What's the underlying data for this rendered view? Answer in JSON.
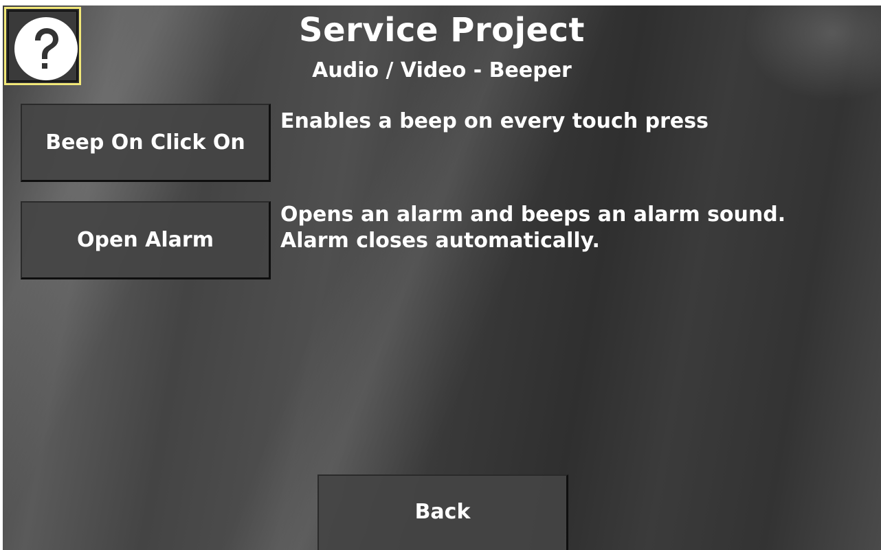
{
  "header": {
    "title": "Service Project",
    "subtitle": "Audio / Video - Beeper"
  },
  "help_button": {
    "icon": "question-mark-icon",
    "highlight_color": "#f2e879"
  },
  "items": [
    {
      "button_label": "Beep On Click On",
      "description_lines": [
        "Enables a beep on every touch press"
      ]
    },
    {
      "button_label": "Open Alarm",
      "description_lines": [
        "Opens an alarm and beeps an alarm sound.",
        "Alarm closes automatically."
      ]
    }
  ],
  "footer": {
    "back_label": "Back"
  }
}
